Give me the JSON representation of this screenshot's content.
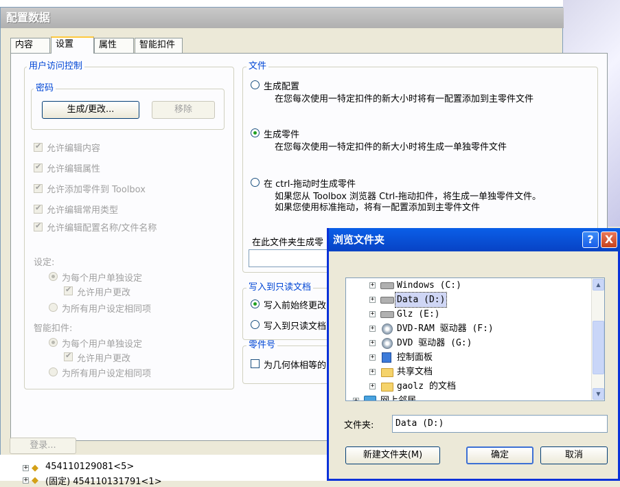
{
  "window": {
    "title": "配置数据",
    "tabs": [
      {
        "label": "内容"
      },
      {
        "label": "设置"
      },
      {
        "label": "属性"
      },
      {
        "label": "智能扣件"
      }
    ]
  },
  "user_access": {
    "title": "用户访问控制",
    "password_group": "密码",
    "generate_btn": "生成/更改...",
    "remove_btn": "移除",
    "checks": [
      {
        "label": "允许编辑内容"
      },
      {
        "label": "允许编辑属性"
      },
      {
        "label": "允许添加零件到 Toolbox"
      },
      {
        "label": "允许编辑常用类型"
      },
      {
        "label": "允许编辑配置名称/文件名称"
      }
    ],
    "settings_label": "设定:",
    "settings_opt1": "为每个用户单独设定",
    "settings_allow": "允许用户更改",
    "settings_opt2": "为所有用户设定相同项",
    "smart_label": "智能扣件:",
    "smart_opt1": "为每个用户单独设定",
    "smart_allow": "允许用户更改",
    "smart_opt2": "为所有用户设定相同项"
  },
  "file_group": {
    "title": "文件",
    "opt1_label": "生成配置",
    "opt1_desc": "在您每次使用一特定扣件的新大小时将有一配置添加到主零件文件",
    "opt2_label": "生成零件",
    "opt2_desc": "在您每次使用一特定扣件的新大小时将生成一单独零件文件",
    "opt3_label": "在 ctrl-拖动时生成零件",
    "opt3_desc": "如果您从 Toolbox 浏览器 Ctrl-拖动扣件，将生成一单独零件文件。如果您使用标准拖动，将有一配置添加到主零件文件",
    "folder_label": "在此文件夹生成零"
  },
  "readonly_group": {
    "title": "写入到只读文档",
    "opt1": "写入前始终更改",
    "opt2": "写入到只读文档"
  },
  "partno_group": {
    "title": "零件号",
    "check": "为几何体相等的"
  },
  "bottom": {
    "login_btn": "登录...",
    "tree_item1": "454110129081<5>",
    "tree_item2": "(固定) 454110131791<1>"
  },
  "dialog": {
    "title": "浏览文件夹",
    "help": "?",
    "close": "X",
    "tree": [
      {
        "label": "Windows (C:)",
        "icon": "drive-icon"
      },
      {
        "label": "Data (D:)",
        "icon": "drive-icon",
        "selected": true
      },
      {
        "label": "Glz (E:)",
        "icon": "drive-icon"
      },
      {
        "label": "DVD-RAM 驱动器 (F:)",
        "icon": "cd-drive-icon"
      },
      {
        "label": "DVD 驱动器 (G:)",
        "icon": "cd-drive-icon"
      },
      {
        "label": "控制面板",
        "icon": "control-panel-icon"
      },
      {
        "label": "共享文档",
        "icon": "folder-icon"
      },
      {
        "label": "gaolz 的文档",
        "icon": "folder-icon"
      },
      {
        "label": "网上邻居",
        "icon": "network-icon"
      }
    ],
    "folder_label": "文件夹:",
    "folder_value": "Data (D:)",
    "new_folder_btn": "新建文件夹(M)",
    "ok_btn": "确定",
    "cancel_btn": "取消"
  }
}
